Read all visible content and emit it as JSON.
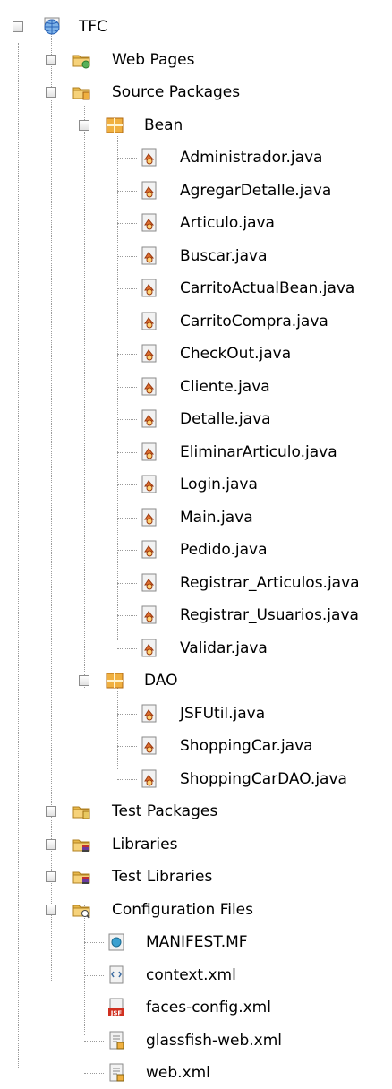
{
  "project": {
    "label": "TFC",
    "icon": "globe-project-icon"
  },
  "nodes": {
    "web_pages": {
      "label": "Web Pages",
      "icon": "web-pages-folder-icon"
    },
    "source_packages": {
      "label": "Source Packages",
      "icon": "source-folder-icon"
    },
    "bean": {
      "label": "Bean",
      "icon": "package-icon",
      "files": [
        "Administrador.java",
        "AgregarDetalle.java",
        "Articulo.java",
        "Buscar.java",
        "CarritoActualBean.java",
        "CarritoCompra.java",
        "CheckOut.java",
        "Cliente.java",
        "Detalle.java",
        "EliminarArticulo.java",
        "Login.java",
        "Main.java",
        "Pedido.java",
        "Registrar_Articulos.java",
        "Registrar_Usuarios.java",
        "Validar.java"
      ]
    },
    "dao": {
      "label": "DAO",
      "icon": "package-icon",
      "files": [
        "JSFUtil.java",
        "ShoppingCar.java",
        "ShoppingCarDAO.java"
      ]
    },
    "test_packages": {
      "label": "Test Packages",
      "icon": "test-folder-icon"
    },
    "libraries": {
      "label": "Libraries",
      "icon": "library-folder-icon"
    },
    "test_libraries": {
      "label": "Test Libraries",
      "icon": "library-folder-icon"
    },
    "configuration_files": {
      "label": "Configuration Files",
      "icon": "config-folder-icon",
      "files": [
        {
          "label": "MANIFEST.MF",
          "icon": "manifest-icon"
        },
        {
          "label": "context.xml",
          "icon": "xml-icon"
        },
        {
          "label": "faces-config.xml",
          "icon": "jsf-icon"
        },
        {
          "label": "glassfish-web.xml",
          "icon": "xml-config-icon"
        },
        {
          "label": "web.xml",
          "icon": "xml-config-icon"
        }
      ]
    }
  },
  "toggles": {
    "expand": "+",
    "collapse": "−"
  },
  "colors": {
    "folder": "#e8b84a",
    "package": "#f0b040",
    "java": "#e07030",
    "jsf": "#d03020",
    "manifest": "#3aa0d0",
    "globe": "#2a64b8"
  }
}
